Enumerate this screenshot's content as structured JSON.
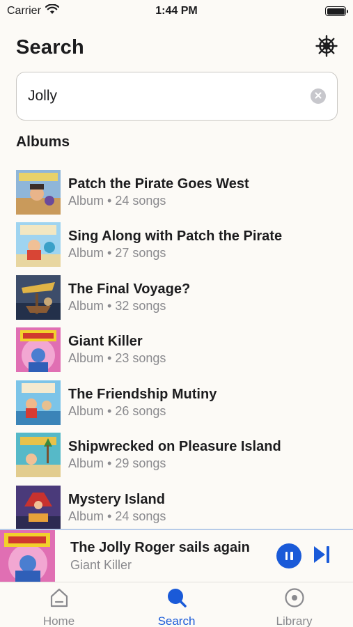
{
  "status_bar": {
    "carrier": "Carrier",
    "time": "1:44 PM"
  },
  "header": {
    "title": "Search",
    "settings_icon": "ship-wheel-icon"
  },
  "search": {
    "value": "Jolly",
    "clear_icon": "clear-icon"
  },
  "sections": {
    "albums_title": "Albums"
  },
  "albums": [
    {
      "title": "Patch the Pirate Goes West",
      "subtitle": "Album • 24 songs"
    },
    {
      "title": "Sing Along with Patch the Pirate",
      "subtitle": "Album • 27 songs"
    },
    {
      "title": "The Final Voyage?",
      "subtitle": "Album • 32 songs"
    },
    {
      "title": "Giant Killer",
      "subtitle": "Album • 23 songs"
    },
    {
      "title": "The Friendship Mutiny",
      "subtitle": "Album • 26 songs"
    },
    {
      "title": "Shipwrecked on Pleasure Island",
      "subtitle": "Album • 29 songs"
    },
    {
      "title": "Mystery Island",
      "subtitle": "Album • 24 songs"
    }
  ],
  "now_playing": {
    "title": "The Jolly Roger sails again",
    "subtitle": "Giant Killer"
  },
  "tabs": [
    {
      "label": "Home",
      "icon": "home-icon"
    },
    {
      "label": "Search",
      "icon": "search-icon",
      "active": true
    },
    {
      "label": "Library",
      "icon": "library-icon"
    }
  ],
  "colors": {
    "accent": "#1a5ad8",
    "background": "#FCFAF6",
    "secondary_text": "#8a8a8e"
  }
}
